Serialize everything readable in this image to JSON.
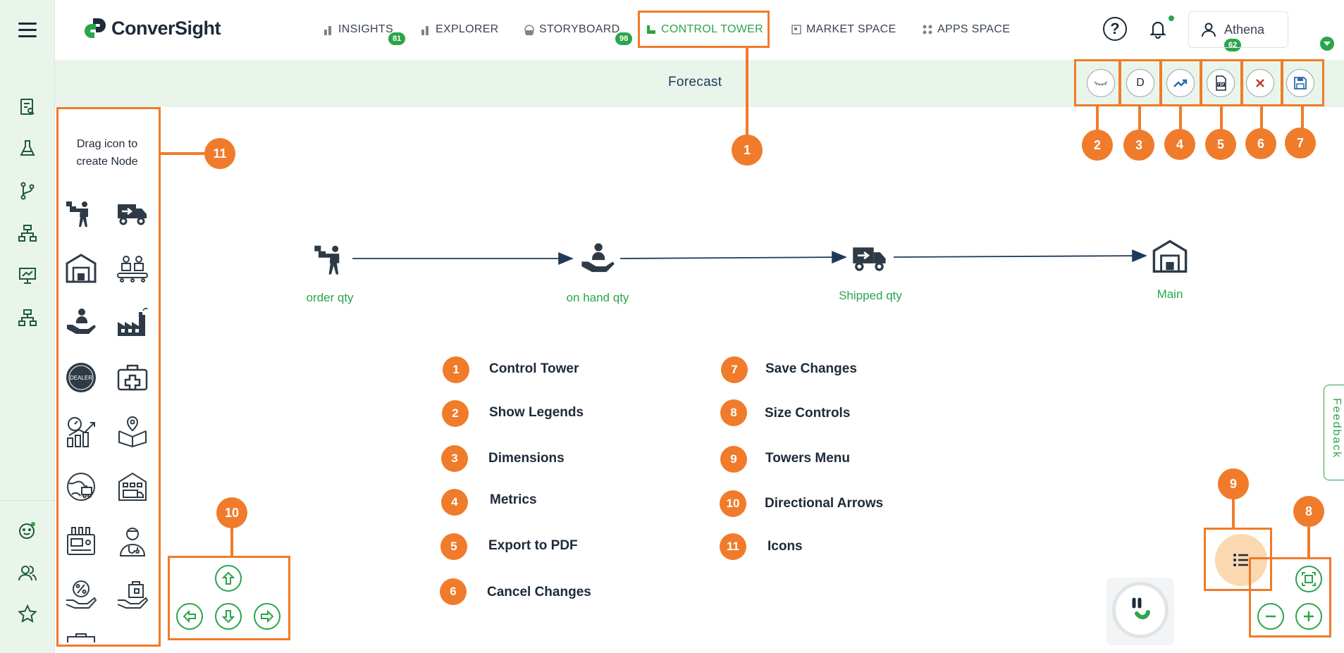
{
  "brand": {
    "name": "ConverSight",
    "accent": "#2aa54a",
    "annotation_color": "#f07b2a"
  },
  "nav": {
    "items": [
      {
        "label": "INSIGHTS",
        "icon": "bar-chart-icon",
        "badge": "81"
      },
      {
        "label": "EXPLORER",
        "icon": "bar-chart-icon"
      },
      {
        "label": "STORYBOARD",
        "icon": "storyboard-icon",
        "badge": "98"
      },
      {
        "label": "CONTROL TOWER",
        "icon": "control-tower-icon",
        "active": true
      },
      {
        "label": "MARKET SPACE",
        "icon": "market-space-icon"
      },
      {
        "label": "APPS SPACE",
        "icon": "apps-grid-icon"
      }
    ],
    "help_label": "?",
    "notifications_badge": "62",
    "user_name": "Athena"
  },
  "page": {
    "title": "Forecast"
  },
  "toolbar": {
    "dimensions_label": "D"
  },
  "palette": {
    "hint": "Drag icon to create Node"
  },
  "flow": {
    "nodes": [
      {
        "label": "order qty",
        "icon": "order-worker-icon"
      },
      {
        "label": "on hand qty",
        "icon": "hand-holding-person-icon"
      },
      {
        "label": "Shipped qty",
        "icon": "delivery-truck-icon"
      },
      {
        "label": "Main",
        "icon": "warehouse-icon"
      }
    ]
  },
  "annotations": [
    "1",
    "2",
    "3",
    "4",
    "5",
    "6",
    "7",
    "8",
    "9",
    "10",
    "11"
  ],
  "legend": {
    "left": [
      {
        "num": "1",
        "label": "Control Tower"
      },
      {
        "num": "2",
        "label": "Show Legends"
      },
      {
        "num": "3",
        "label": "Dimensions"
      },
      {
        "num": "4",
        "label": "Metrics"
      },
      {
        "num": "5",
        "label": "Export to PDF"
      },
      {
        "num": "6",
        "label": "Cancel Changes"
      }
    ],
    "right": [
      {
        "num": "7",
        "label": "Save Changes"
      },
      {
        "num": "8",
        "label": "Size Controls"
      },
      {
        "num": "9",
        "label": "Towers Menu"
      },
      {
        "num": "10",
        "label": "Directional Arrows"
      },
      {
        "num": "11",
        "label": "Icons"
      }
    ]
  },
  "feedback_label": "Feedback"
}
